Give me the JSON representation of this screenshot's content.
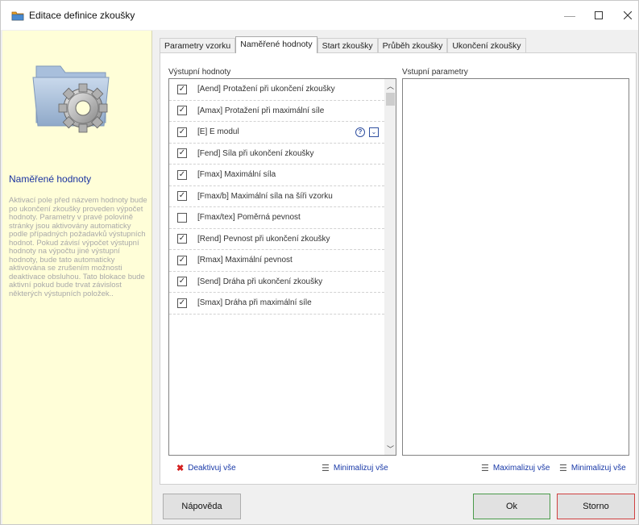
{
  "window": {
    "title": "Editace definice zkoušky"
  },
  "sidebar": {
    "title": "Naměřené hodnoty",
    "description": "Aktivací pole před názvem hodnoty bude po ukončení zkoušky proveden výpočet hodnoty. Parametry v pravé polovině stránky jsou aktivovány automaticky podle případných požadavků výstupních hodnot. Pokud závisí výpočet výstupní hodnoty na výpočtu jiné výstupní hodnoty, bude tato automaticky aktivována se zrušením možnosti deaktivace obsluhou. Tato blokace bude aktivní pokud bude trvat závislost některých výstupních položek.."
  },
  "tabs": [
    {
      "label": "Parametry vzorku",
      "active": false
    },
    {
      "label": "Naměřené hodnoty",
      "active": true
    },
    {
      "label": "Start zkoušky",
      "active": false
    },
    {
      "label": "Průběh zkoušky",
      "active": false
    },
    {
      "label": "Ukončení zkoušky",
      "active": false
    }
  ],
  "output": {
    "label": "Výstupní hodnoty",
    "items": [
      {
        "label": "[Aend]  Protažení při ukončení zkoušky",
        "checked": true
      },
      {
        "label": "[Amax]  Protažení při maximální síle",
        "checked": true
      },
      {
        "label": "[E]  E modul",
        "checked": true,
        "help": "?",
        "expand": "⌄"
      },
      {
        "label": "[Fend]  Síla při ukončení zkoušky",
        "checked": true
      },
      {
        "label": "[Fmax]  Maximální síla",
        "checked": true
      },
      {
        "label": "[Fmax/b]  Maximální síla na šíři vzorku",
        "checked": true
      },
      {
        "label": "[Fmax/tex]  Poměrná pevnost",
        "checked": false
      },
      {
        "label": "[Rend]  Pevnost při ukončení zkoušky",
        "checked": true
      },
      {
        "label": "[Rmax]  Maximální pevnost",
        "checked": true
      },
      {
        "label": "[Send]  Dráha při ukončení zkoušky",
        "checked": true
      },
      {
        "label": "[Smax]  Dráha při maximální síle",
        "checked": true
      }
    ],
    "deactivate_all": "Deaktivuj vše",
    "minimize_all": "Minimalizuj vše"
  },
  "input": {
    "label": "Vstupní parametry",
    "maximize_all": "Maximalizuj vše",
    "minimize_all": "Minimalizuj vše"
  },
  "buttons": {
    "help": "Nápověda",
    "ok": "Ok",
    "cancel": "Storno"
  }
}
